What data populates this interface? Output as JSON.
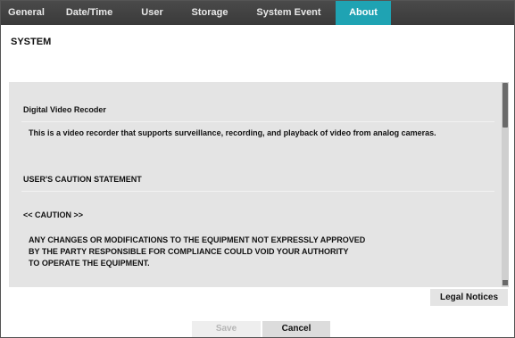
{
  "tabs": [
    {
      "label": "General"
    },
    {
      "label": "Date/Time"
    },
    {
      "label": "User"
    },
    {
      "label": "Storage"
    },
    {
      "label": "System Event"
    },
    {
      "label": "About",
      "active": true
    }
  ],
  "section_title": "SYSTEM",
  "content": {
    "product_heading": "Digital Video Recoder",
    "product_desc": "This is a video recorder that supports surveillance, recording, and playback of video from analog cameras.",
    "caution_heading": "USER'S CAUTION STATEMENT",
    "caution_label": "<< CAUTION >>",
    "caution_lines": [
      "ANY CHANGES OR MODIFICATIONS TO THE EQUIPMENT NOT EXPRESSLY APPROVED",
      "BY THE PARTY RESPONSIBLE FOR COMPLIANCE COULD VOID YOUR AUTHORITY",
      "TO OPERATE THE EQUIPMENT."
    ]
  },
  "legal_notices_label": "Legal Notices",
  "buttons": {
    "save": "Save",
    "cancel": "Cancel"
  },
  "colors": {
    "tab_bar": "#3f3f3f",
    "active_tab": "#1fa3b3",
    "panel": "#e4e4e4"
  }
}
